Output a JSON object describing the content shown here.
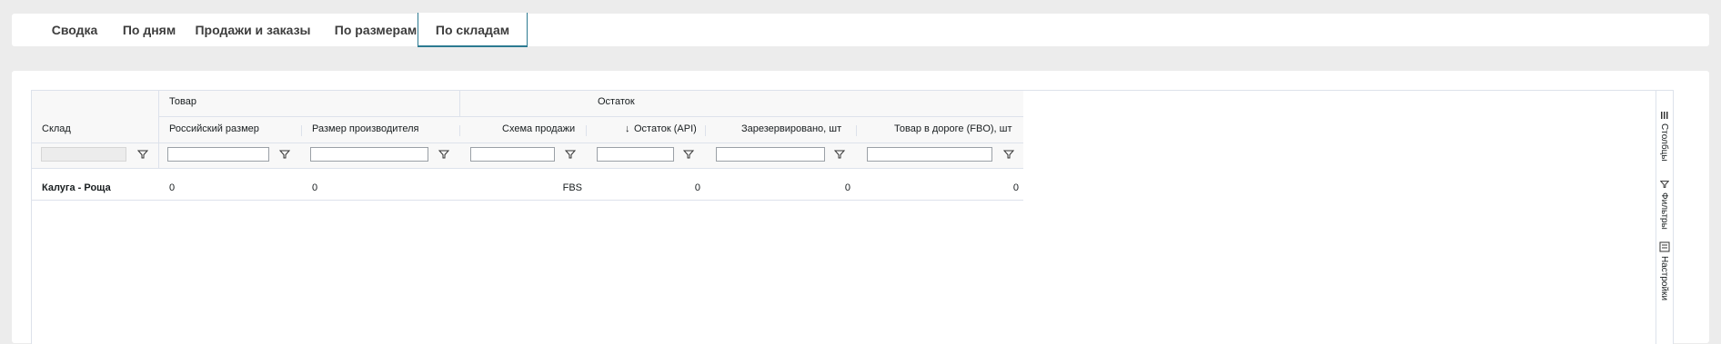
{
  "tabs": [
    {
      "label": "Сводка"
    },
    {
      "label": "По дням"
    },
    {
      "label": "Продажи и заказы"
    },
    {
      "label": "По размерам"
    },
    {
      "label": "По складам",
      "active": true
    }
  ],
  "grid": {
    "groups": {
      "product": "Товар",
      "stock": "Остаток"
    },
    "columns": {
      "warehouse": "Склад",
      "ru_size": "Российский размер",
      "maker_size": "Размер производителя",
      "scheme": "Схема продажи",
      "stock_api": "Остаток (API)",
      "reserved": "Зарезервировано, шт",
      "in_transit": "Товар в дороге (FBO), шт"
    },
    "sort_indicator": "↓",
    "rows": [
      {
        "warehouse": "Калуга - Роща",
        "ru_size": "0",
        "maker_size": "0",
        "scheme": "FBS",
        "stock_api": "0",
        "reserved": "0",
        "in_transit": "0"
      }
    ]
  },
  "side_panel": {
    "columns_label": "Столбцы",
    "filters_label": "Фильтры",
    "settings_label": "Настройки"
  }
}
